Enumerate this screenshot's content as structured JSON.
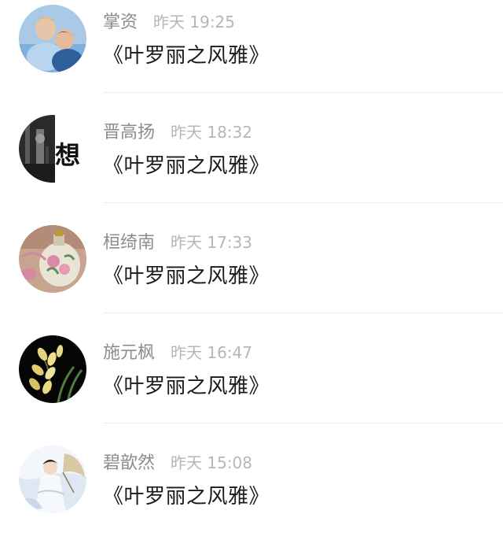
{
  "comments": [
    {
      "name": "掌资",
      "time": "昨天 19:25",
      "message": "《叶罗丽之风雅》",
      "avatar_icon": "couple-photo-avatar"
    },
    {
      "name": "晋高扬",
      "time": "昨天 18:32",
      "message": "《叶罗丽之风雅》",
      "avatar_icon": "dark-photo-avatar",
      "avatar_text": "想"
    },
    {
      "name": "桓绮南",
      "time": "昨天 17:33",
      "message": "《叶罗丽之风雅》",
      "avatar_icon": "porcelain-vase-avatar"
    },
    {
      "name": "施元枫",
      "time": "昨天 16:47",
      "message": "《叶罗丽之风雅》",
      "avatar_icon": "orchid-flower-avatar"
    },
    {
      "name": "碧歆然",
      "time": "昨天 15:08",
      "message": "《叶罗丽之风雅》",
      "avatar_icon": "umbrella-girl-avatar"
    }
  ]
}
